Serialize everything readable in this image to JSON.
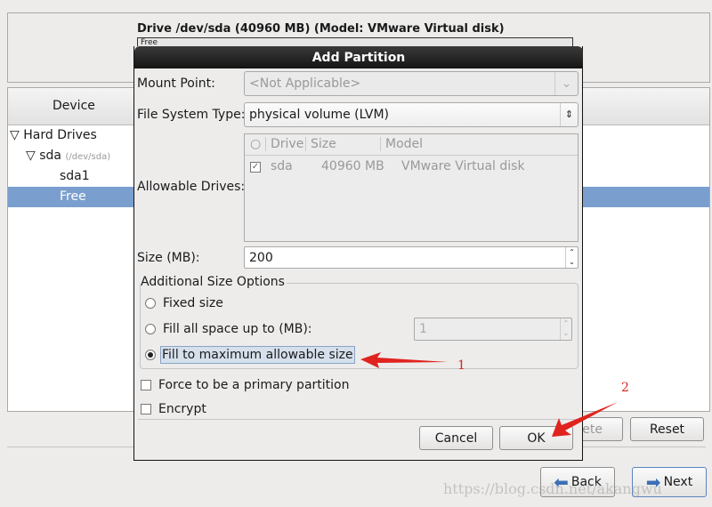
{
  "drive_header": "Drive /dev/sda (40960 MB) (Model: VMware Virtual disk)",
  "drive_bar_label": "Free",
  "tree": {
    "column": "Device",
    "items": [
      {
        "label": "Hard Drives",
        "sub": ""
      },
      {
        "label": "sda",
        "sub": "(/dev/sda)"
      },
      {
        "label": "sda1",
        "sub": ""
      },
      {
        "label": "Free",
        "sub": "",
        "selected": true
      }
    ]
  },
  "main_buttons": {
    "delete": "Delete",
    "reset": "Reset",
    "back": "Back",
    "next": "Next"
  },
  "dialog": {
    "title": "Add Partition",
    "mount_point_label": "Mount Point:",
    "mount_point_value": "<Not Applicable>",
    "fs_type_label": "File System Type:",
    "fs_type_value": "physical volume (LVM)",
    "drives_label": "Allowable Drives:",
    "drives_columns": [
      "Drive",
      "Size",
      "Model"
    ],
    "drives_rows": [
      {
        "checked": true,
        "drive": "sda",
        "size": "40960 MB",
        "model": "VMware Virtual disk"
      }
    ],
    "size_label": "Size (MB):",
    "size_value": "200",
    "size_options_title": "Additional Size Options",
    "opt_fixed": "Fixed size",
    "opt_fill_upto": "Fill all space up to (MB):",
    "fill_upto_value": "1",
    "opt_fill_max": "Fill to maximum allowable size",
    "selected_option": "Fill to maximum allowable size",
    "primary_label": "Force to be a primary partition",
    "encrypt_label": "Encrypt",
    "cancel": "Cancel",
    "ok": "OK"
  },
  "annotations": {
    "one": "1",
    "two": "2",
    "color": "#e0231e"
  },
  "watermark": "https://blog.csdn.net/akangwu",
  "colors": {
    "selection": "#7a9fcf",
    "titlebar": "#1e1e1e"
  }
}
